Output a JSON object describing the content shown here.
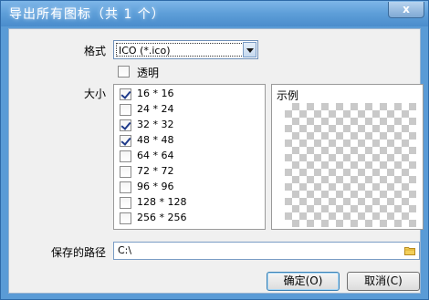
{
  "window": {
    "title": "导出所有图标（共 1 个）",
    "close_glyph": "x"
  },
  "format": {
    "label": "格式",
    "selected": "ICO (*.ico)"
  },
  "transparent": {
    "label": "透明",
    "checked": false
  },
  "size": {
    "label": "大小",
    "items": [
      {
        "label": "16 * 16",
        "checked": true
      },
      {
        "label": "24 * 24",
        "checked": false
      },
      {
        "label": "32 * 32",
        "checked": true
      },
      {
        "label": "48 * 48",
        "checked": true
      },
      {
        "label": "64 * 64",
        "checked": false
      },
      {
        "label": "72 * 72",
        "checked": false
      },
      {
        "label": "96 * 96",
        "checked": false
      },
      {
        "label": "128 * 128",
        "checked": false
      },
      {
        "label": "256 * 256",
        "checked": false
      }
    ]
  },
  "preview": {
    "label": "示例"
  },
  "save_path": {
    "label": "保存的路径",
    "value": "C:\\",
    "icon": "folder-icon"
  },
  "buttons": {
    "ok_label": "确定(O)",
    "cancel_label": "取消(C)"
  },
  "colors": {
    "title_bar": "#5d9ed8",
    "dialog_bg": "#f0f0f0"
  }
}
